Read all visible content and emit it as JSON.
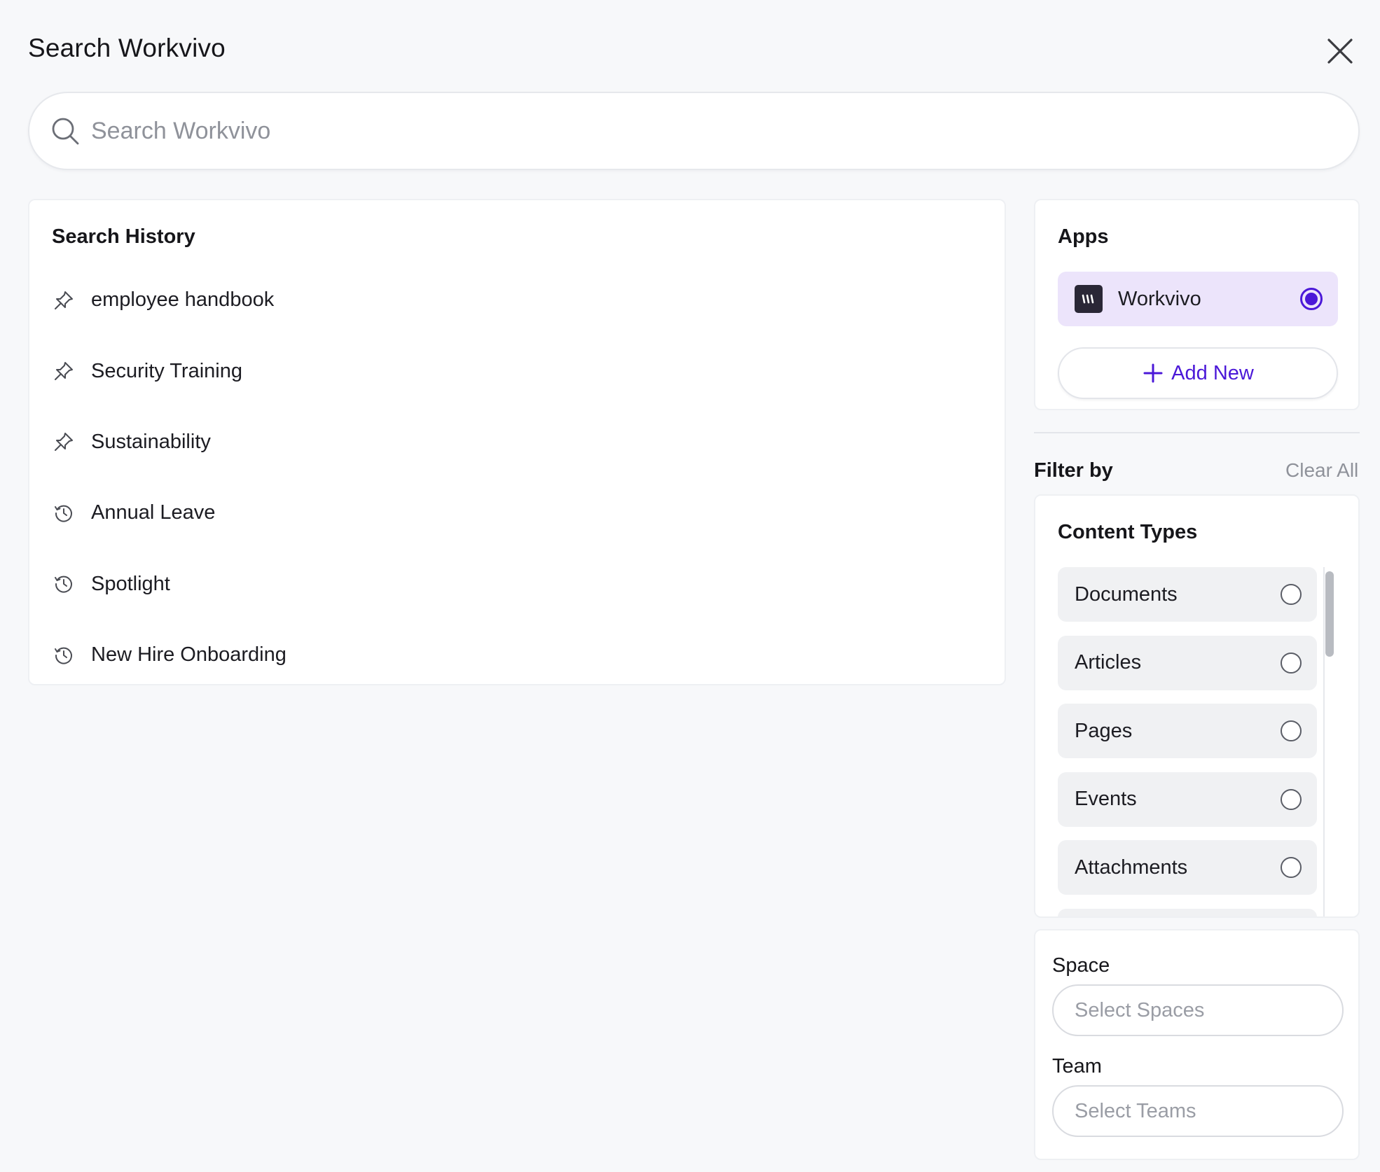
{
  "header": {
    "title": "Search Workvivo",
    "close_icon": "close-icon"
  },
  "search": {
    "placeholder": "Search Workvivo",
    "value": "",
    "icon": "search-icon"
  },
  "search_history": {
    "title": "Search History",
    "items": [
      {
        "label": "employee handbook",
        "icon": "pin-icon"
      },
      {
        "label": "Security Training",
        "icon": "pin-icon"
      },
      {
        "label": "Sustainability",
        "icon": "pin-icon"
      },
      {
        "label": "Annual Leave",
        "icon": "history-icon"
      },
      {
        "label": "Spotlight",
        "icon": "history-icon"
      },
      {
        "label": "New Hire Onboarding",
        "icon": "history-icon"
      }
    ]
  },
  "apps": {
    "title": "Apps",
    "items": [
      {
        "name": "Workvivo",
        "selected": true,
        "icon": "workvivo-logo-icon"
      }
    ],
    "add_label": "Add New"
  },
  "filters": {
    "title": "Filter by",
    "clear_label": "Clear All",
    "content_types": {
      "title": "Content Types",
      "items": [
        {
          "label": "Documents",
          "selected": false
        },
        {
          "label": "Articles",
          "selected": false
        },
        {
          "label": "Pages",
          "selected": false
        },
        {
          "label": "Events",
          "selected": false
        },
        {
          "label": "Attachments",
          "selected": false
        }
      ]
    },
    "space": {
      "label": "Space",
      "placeholder": "Select Spaces"
    },
    "team": {
      "label": "Team",
      "placeholder": "Select Teams"
    }
  },
  "colors": {
    "accent": "#4b18d8",
    "selected_app_bg": "#ece4fb",
    "page_bg": "#f7f8fa",
    "muted_text": "#8f929a"
  }
}
